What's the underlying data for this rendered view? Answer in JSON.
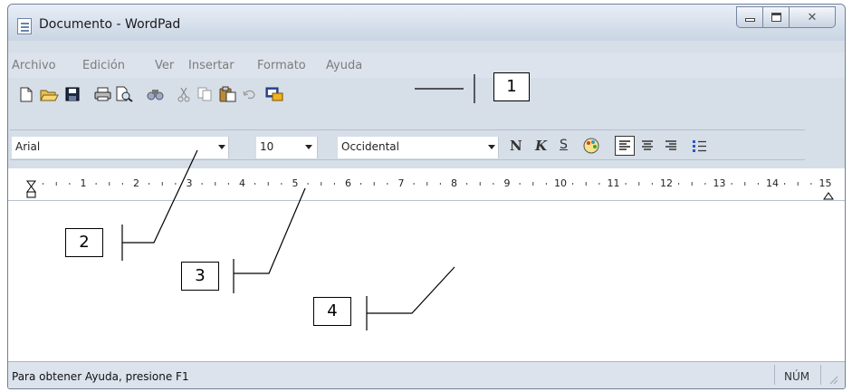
{
  "window": {
    "title": "Documento - WordPad",
    "close_glyph": "✕"
  },
  "menu": [
    "Archivo",
    "Edición",
    "Ver",
    "Insertar",
    "Formato",
    "Ayuda"
  ],
  "format_bar": {
    "font": "Arial",
    "size": "10",
    "script": "Occidental",
    "bold": "N",
    "italic": "K",
    "underline": "S"
  },
  "ruler": {
    "numbers": [
      "1",
      "2",
      "3",
      "4",
      "5",
      "6",
      "7",
      "8",
      "9",
      "10",
      "11",
      "12",
      "13",
      "14",
      "15"
    ]
  },
  "status": {
    "help_text": "Para obtener Ayuda, presione F1",
    "num_indicator": "NÚM"
  },
  "callouts": [
    "1",
    "2",
    "3",
    "4"
  ],
  "icons": [
    "new-document-icon",
    "open-folder-icon",
    "save-icon",
    "print-icon",
    "print-preview-icon",
    "find-icon",
    "cut-icon",
    "copy-icon",
    "paste-icon",
    "undo-icon",
    "insert-object-icon",
    "color-icon",
    "align-left-icon",
    "align-center-icon",
    "align-right-icon",
    "bullets-icon"
  ]
}
